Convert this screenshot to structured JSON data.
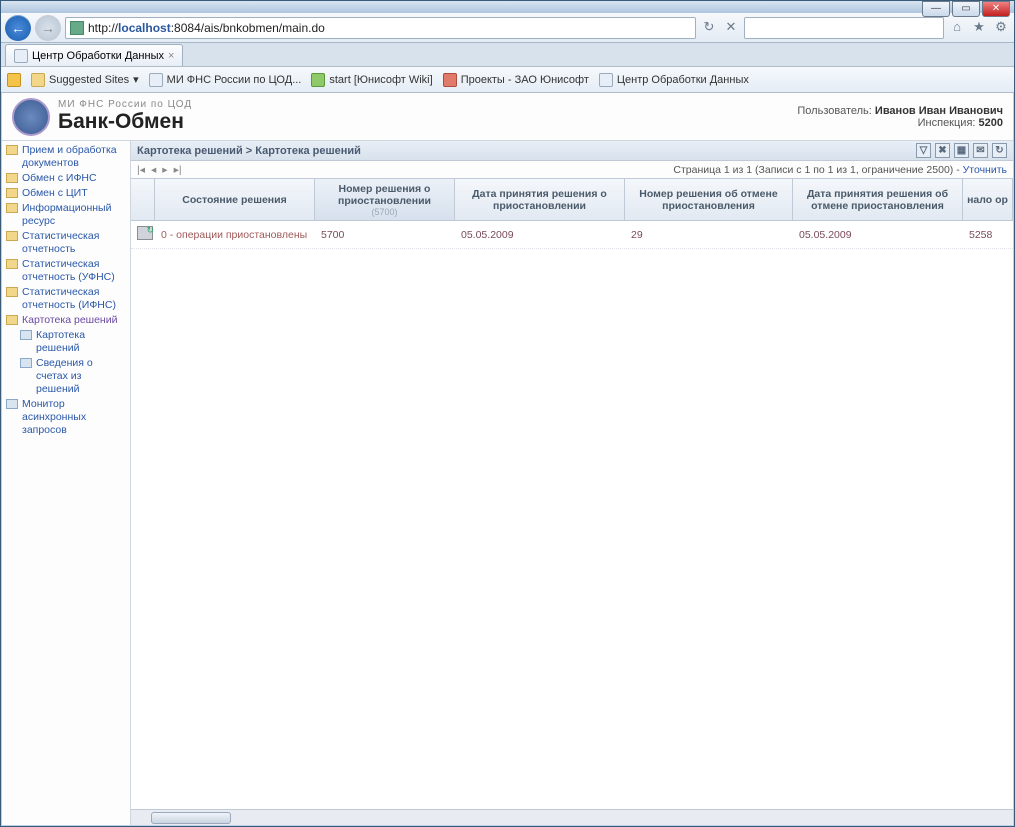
{
  "browser": {
    "url_prefix": "http://",
    "url_host": "localhost",
    "url_port_path": ":8084/ais/bnkobmen/main.do",
    "tab_title": "Центр Обработки Данных",
    "bookmarks": {
      "suggested": "Suggested Sites",
      "b1": "МИ ФНС России по ЦОД...",
      "b2": "start [Юнисофт Wiki]",
      "b3": "Проекты - ЗАО Юнисофт",
      "b4": "Центр Обработки Данных"
    }
  },
  "app": {
    "subtitle": "МИ ФНС России по ЦОД",
    "title": "Банк-Обмен",
    "user_label": "Пользователь:",
    "user_name": "Иванов Иван Иванович",
    "insp_label": "Инспекция:",
    "insp_value": "5200"
  },
  "sidebar": {
    "items": [
      "Прием и обработка документов",
      "Обмен с ИФНС",
      "Обмен с ЦИТ",
      "Информационный ресурс",
      "Статистическая отчетность",
      "Статистическая отчетность (УФНС)",
      "Статистическая отчетность (ИФНС)",
      "Картотека решений",
      "Картотека решений",
      "Сведения о счетах из решений",
      "Монитор асинхронных запросов"
    ]
  },
  "crumb": "Картотека решений > Картотека решений",
  "pager": {
    "info": "Страница 1 из 1 (Записи с 1 по 1 из 1, ограничение 2500) - ",
    "refine": "Уточнить"
  },
  "table": {
    "headers": {
      "h1": "Состояние решения",
      "h2": "Номер решения о приостановлении",
      "h2sub": "(5700)",
      "h3": "Дата принятия решения о приостановлении",
      "h4": "Номер решения об отмене приостановления",
      "h5": "Дата принятия решения об отмене приостановления",
      "h6": "нало ор"
    },
    "row": {
      "status": "0 - операции приостановлены",
      "c2": "5700",
      "c3": "05.05.2009",
      "c4": "29",
      "c5": "05.05.2009",
      "c6": "5258"
    }
  }
}
